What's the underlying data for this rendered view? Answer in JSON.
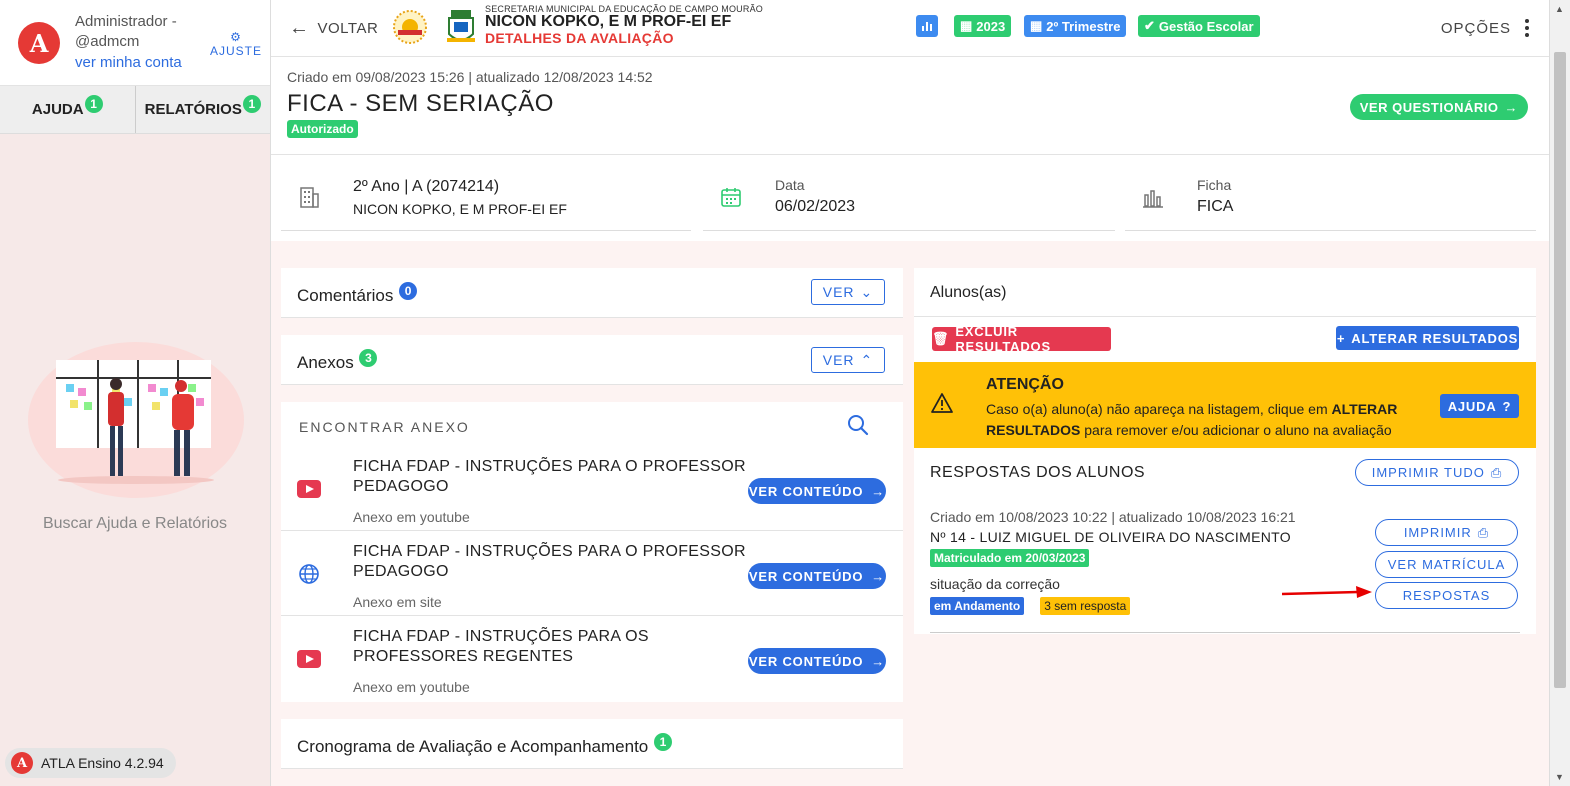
{
  "sidebar": {
    "user_name": "Administrador - @admcm",
    "account_link": "ver minha conta",
    "settings_label": "AJUSTE",
    "tabs": [
      {
        "label": "AJUDA",
        "badge": "1"
      },
      {
        "label": "RELATÓRIOS",
        "badge": "1"
      }
    ],
    "help_text": "Buscar Ajuda e Relatórios",
    "version": "ATLA Ensino 4.2.94"
  },
  "topbar": {
    "back_label": "VOLTAR",
    "secretaria": "SECRETARIA MUNICIPAL DA EDUCAÇÃO DE CAMPO MOURÃO",
    "school": "NICON KOPKO, E M PROF-EI EF",
    "subtitle": "DETALHES DA AVALIAÇÃO",
    "chips": {
      "year": "2023",
      "term": "2º Trimestre",
      "management": "Gestão Escolar"
    },
    "options_label": "OPÇÕES"
  },
  "header": {
    "created": "Criado em 09/08/2023 15:26 | atualizado 12/08/2023 14:52",
    "title": "FICA - SEM SERIAÇÃO",
    "status": "Autorizado",
    "questionnaire_button": "VER QUESTIONÁRIO"
  },
  "info": {
    "class_label": "2º Ano | A (2074214)",
    "class_value": "NICON KOPKO, E M PROF-EI EF",
    "date_label": "Data",
    "date_value": "06/02/2023",
    "sheet_label": "Ficha",
    "sheet_value": "FICA"
  },
  "comments": {
    "title": "Comentários",
    "badge": "0",
    "button": "VER"
  },
  "attachments": {
    "title": "Anexos",
    "badge": "3",
    "button": "VER",
    "search_label": "ENCONTRAR ANEXO",
    "content_button": "VER CONTEÚDO",
    "items": [
      {
        "title": "FICHA FDAP - INSTRUÇÕES PARA O PROFESSOR PEDAGOGO",
        "type": "Anexo em youtube",
        "icon": "youtube-icon"
      },
      {
        "title": "FICHA FDAP - INSTRUÇÕES PARA O PROFESSOR PEDAGOGO",
        "type": "Anexo em site",
        "icon": "globe-icon"
      },
      {
        "title": "FICHA FDAP - INSTRUÇÕES PARA OS PROFESSORES REGENTES",
        "type": "Anexo em youtube",
        "icon": "youtube-icon"
      }
    ]
  },
  "schedule": {
    "title": "Cronograma de Avaliação e Acompanhamento",
    "badge": "1"
  },
  "students": {
    "title": "Alunos(as)",
    "delete_button": "EXCLUIR RESULTADOS",
    "change_button": "ALTERAR RESULTADOS",
    "alert": {
      "title": "ATENÇÃO",
      "text_before": "Caso o(a) aluno(a) não apareça na listagem, clique em ",
      "text_bold": "ALTERAR RESULTADOS",
      "text_after": " para remover e/ou adicionar o aluno na avaliação",
      "help_button": "AJUDA"
    },
    "responses_title": "RESPOSTAS DOS ALUNOS",
    "print_all_button": "IMPRIMIR TUDO",
    "entry": {
      "created": "Criado em 10/08/2023 10:22 | atualizado 10/08/2023 16:21",
      "name": "Nº 14 - LUIZ MIGUEL DE OLIVEIRA DO NASCIMENTO",
      "enrollment_tag": "Matriculado em 20/03/2023",
      "correction_label": "situação da correção",
      "status_tag": "em Andamento",
      "pending_tag": "3 sem resposta",
      "print_button": "IMPRIMIR",
      "enrollment_button": "VER MATRÍCULA",
      "answers_button": "RESPOSTAS"
    }
  },
  "colors": {
    "accent_blue": "#2d6cdf",
    "success_green": "#2ecc71",
    "danger_red": "#e53950",
    "warning_yellow": "#ffc107"
  }
}
